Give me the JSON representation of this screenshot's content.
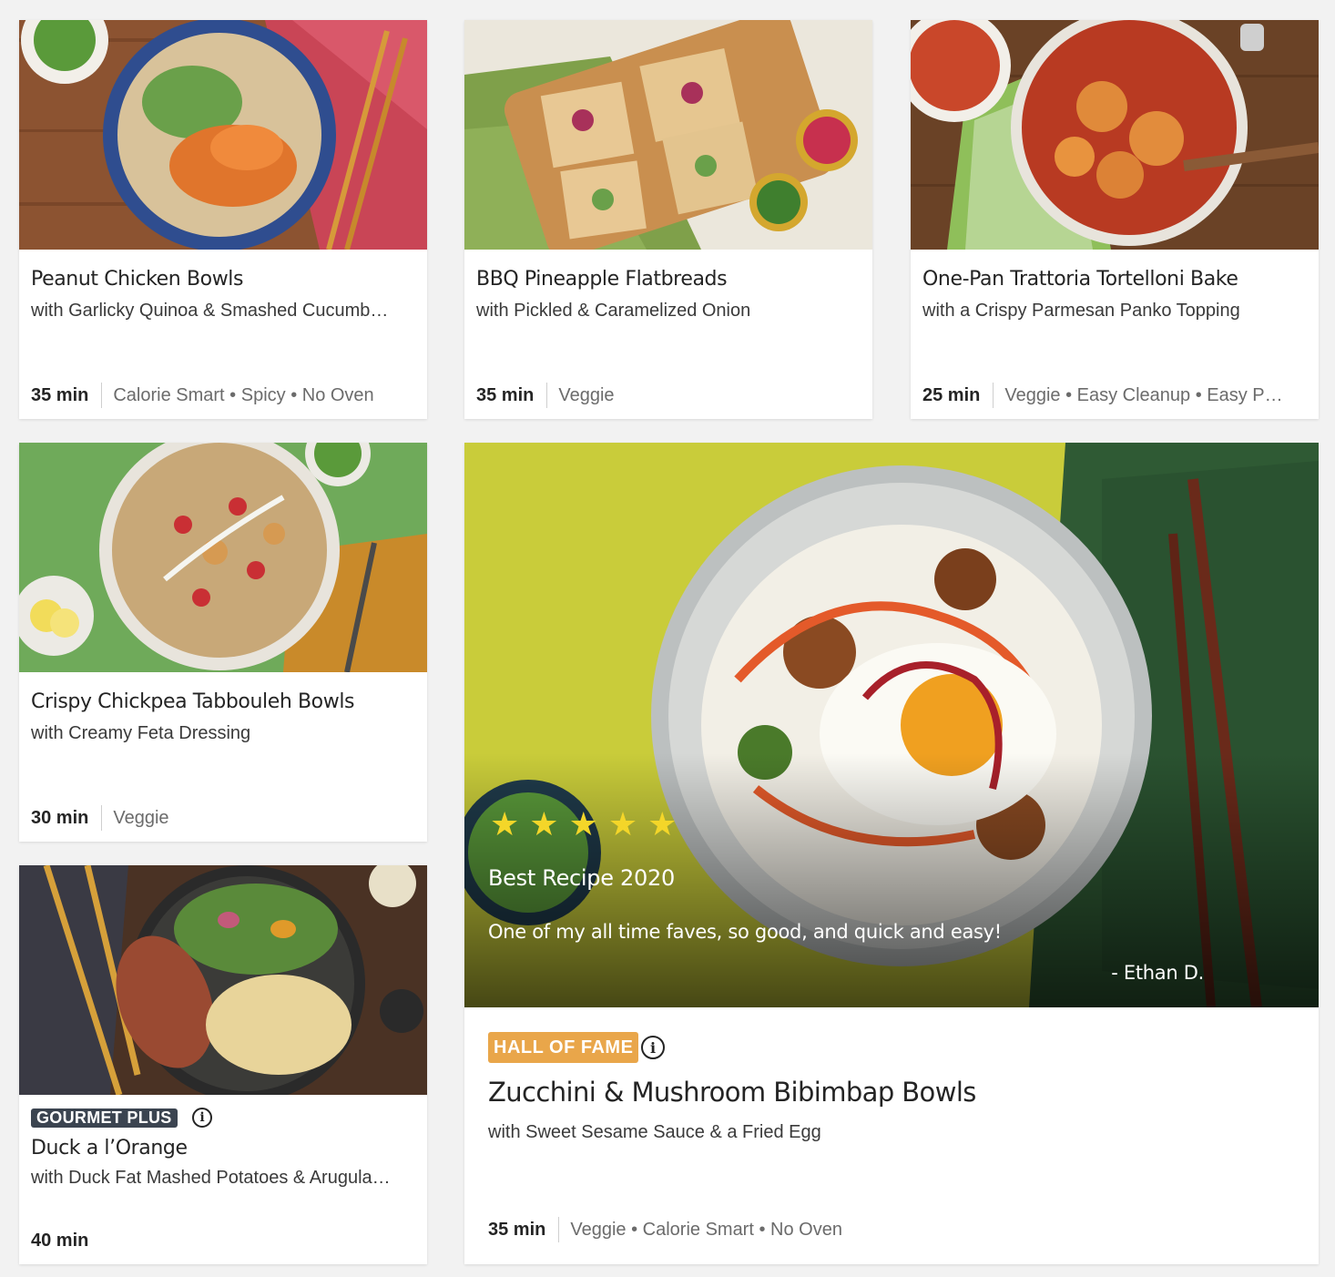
{
  "recipes": [
    {
      "title": "Peanut Chicken Bowls",
      "subtitle": "with Garlicky Quinoa & Smashed Cucumb…",
      "time": "35 min",
      "tags": "Calorie Smart • Spicy • No Oven"
    },
    {
      "title": "BBQ Pineapple Flatbreads",
      "subtitle": "with Pickled & Caramelized Onion",
      "time": "35 min",
      "tags": "Veggie"
    },
    {
      "title": "One-Pan Trattoria Tortelloni Bake",
      "subtitle": "with a Crispy Parmesan Panko Topping",
      "time": "25 min",
      "tags": "Veggie • Easy Cleanup • Easy P…"
    },
    {
      "title": "Crispy Chickpea Tabbouleh Bowls",
      "subtitle": "with Creamy Feta Dressing",
      "time": "30 min",
      "tags": "Veggie"
    },
    {
      "badge": "GOURMET PLUS",
      "title": "Duck a l’Orange",
      "subtitle": "with Duck Fat Mashed Potatoes & Arugula…",
      "time": "40 min",
      "tags": ""
    }
  ],
  "featured": {
    "rating": 5,
    "star_color": "#f4d629",
    "award": "Best Recipe 2020",
    "quote": "One of my all time faves, so good, and quick and easy!",
    "author": "- Ethan D.",
    "badge": "HALL OF FAME",
    "badge_color": "#e9a64a",
    "title": "Zucchini & Mushroom Bibimbap Bowls",
    "subtitle": "with Sweet Sesame Sauce & a Fried Egg",
    "time": "35 min",
    "tags": "Veggie • Calorie Smart • No Oven"
  },
  "icons": {
    "info": "info-icon",
    "star": "star-icon"
  }
}
